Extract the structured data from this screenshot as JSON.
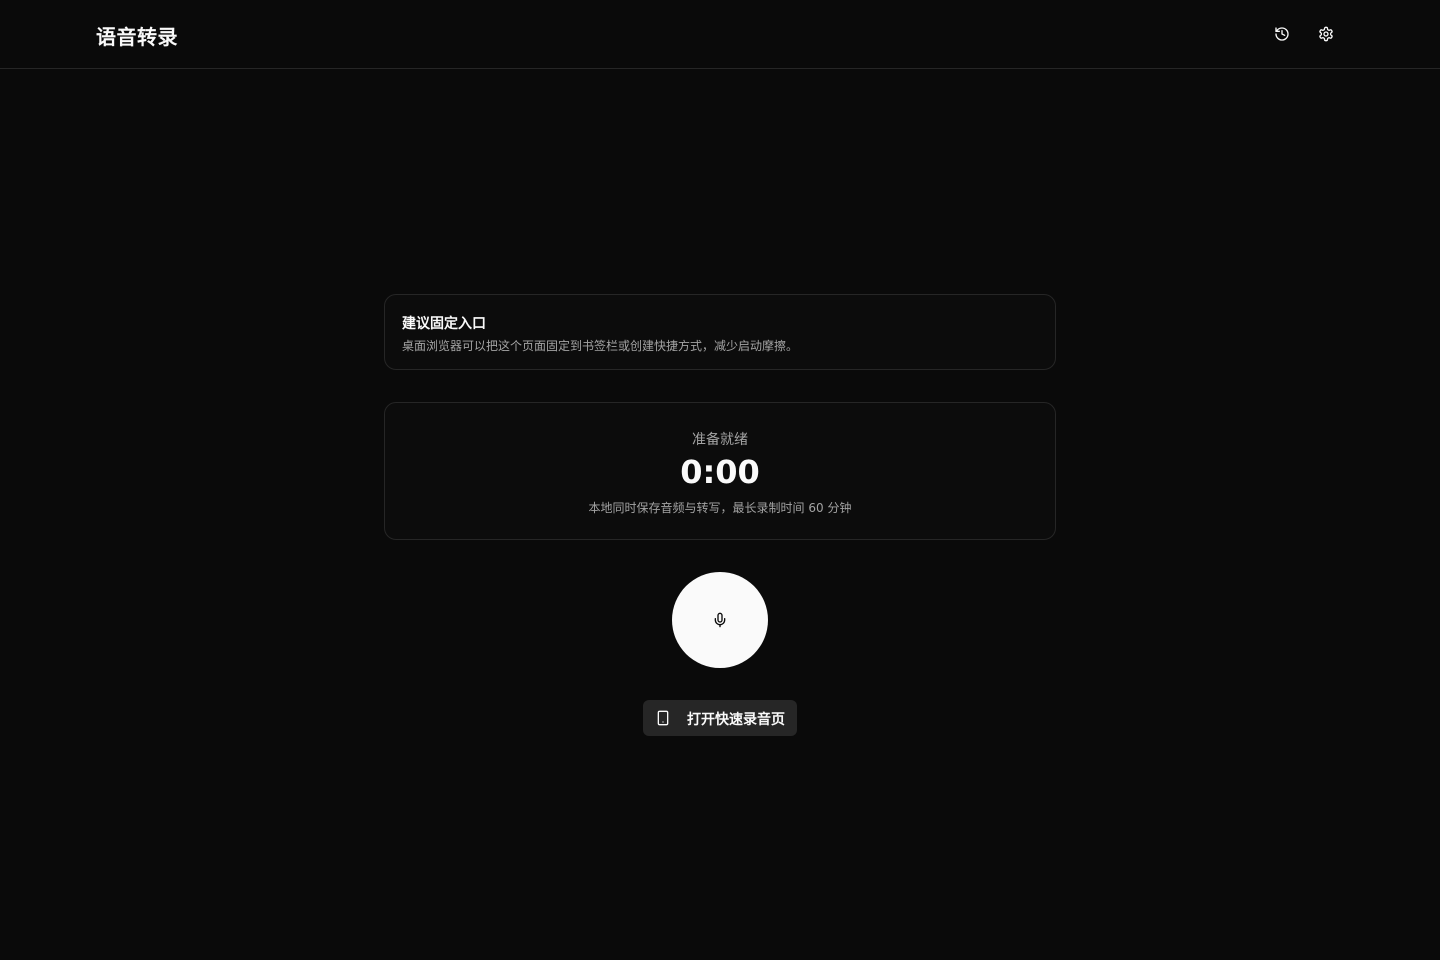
{
  "header": {
    "title": "语音转录",
    "history_icon": "history-icon",
    "settings_icon": "gear-icon"
  },
  "tip": {
    "title": "建议固定入口",
    "description": "桌面浏览器可以把这个页面固定到书签栏或创建快捷方式，减少启动摩擦。"
  },
  "status": {
    "label": "准备就绪",
    "timer": "0:00",
    "note": "本地同时保存音频与转写，最长录制时间 60 分钟"
  },
  "record": {
    "icon": "microphone-icon"
  },
  "quick_open": {
    "icon": "smartphone-icon",
    "label": "打开快速录音页"
  },
  "colors": {
    "background": "#0a0a0a",
    "border": "#262626",
    "primary": "#fafafa",
    "muted_text": "#a3a3a3"
  }
}
